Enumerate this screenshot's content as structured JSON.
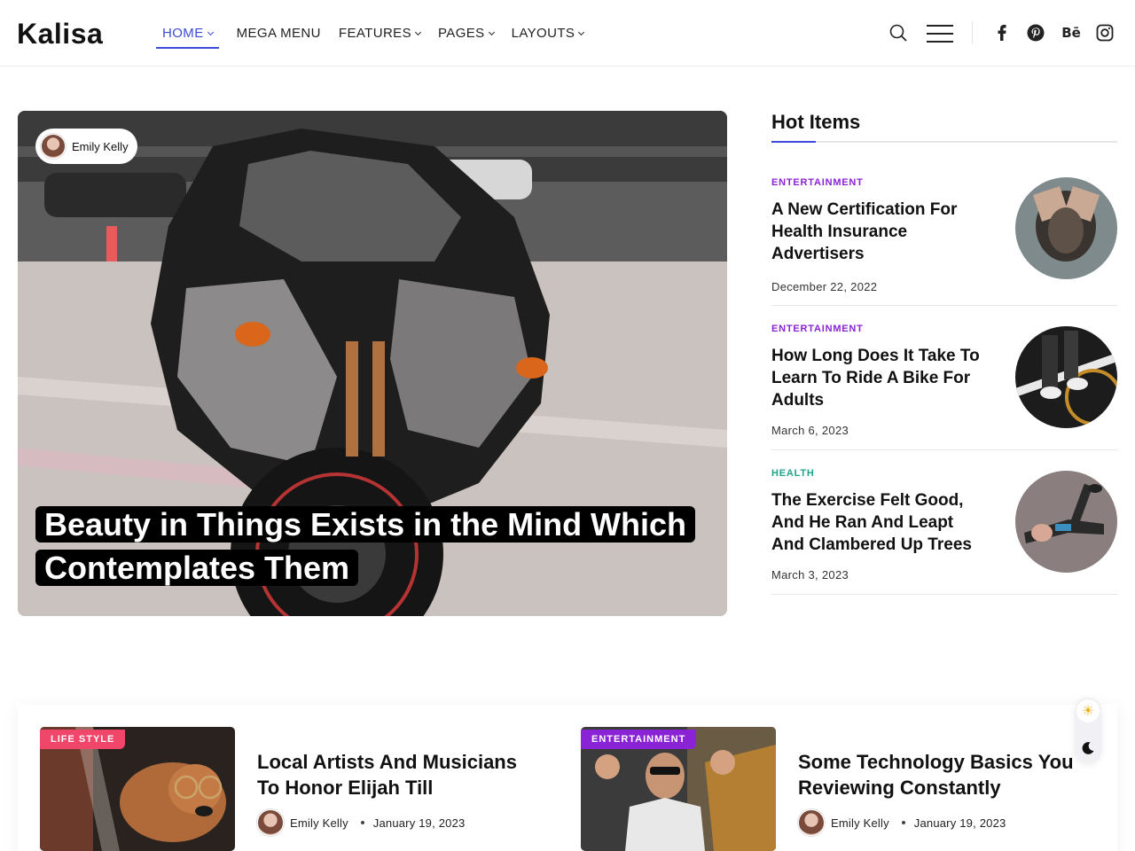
{
  "header": {
    "logo": "Kalisa",
    "nav": [
      {
        "label": "HOME",
        "dropdown": true,
        "active": true
      },
      {
        "label": "MEGA MENU",
        "dropdown": false
      },
      {
        "label": "FEATURES",
        "dropdown": true
      },
      {
        "label": "PAGES",
        "dropdown": true
      },
      {
        "label": "LAYOUTS",
        "dropdown": true
      }
    ],
    "social": [
      "facebook-icon",
      "pinterest-icon",
      "behance-icon",
      "instagram-icon"
    ],
    "behance_text": "Bē"
  },
  "hero": {
    "author": "Emily Kelly",
    "title": "Beauty in Things Exists in the Mind Which Contemplates Them"
  },
  "sidebar": {
    "heading": "Hot Items",
    "items": [
      {
        "category": "ENTERTAINMENT",
        "category_color": "#8a23d6",
        "title": "A New Certification For Health Insurance Advertisers",
        "date": "December 22, 2022"
      },
      {
        "category": "ENTERTAINMENT",
        "category_color": "#8a23d6",
        "title": "How Long Does It Take To Learn To Ride A Bike For Adults",
        "date": "March 6, 2023"
      },
      {
        "category": "HEALTH",
        "category_color": "#1ea58b",
        "title": "The Exercise Felt Good, And He Ran And Leapt And Clambered Up Trees",
        "date": "March 3, 2023"
      }
    ]
  },
  "cards": [
    {
      "badge": "LIFE STYLE",
      "badge_color": "#f0466a",
      "title": "Local Artists And Musicians To Honor Elijah Till",
      "author": "Emily Kelly",
      "date": "January 19, 2023"
    },
    {
      "badge": "ENTERTAINMENT",
      "badge_color": "#8a23d6",
      "title": "Some Technology Basics You Reviewing Constantly",
      "author": "Emily Kelly",
      "date": "January 19, 2023"
    }
  ],
  "colors": {
    "accent": "#3b4bd8",
    "sun": "#f2b01e"
  }
}
